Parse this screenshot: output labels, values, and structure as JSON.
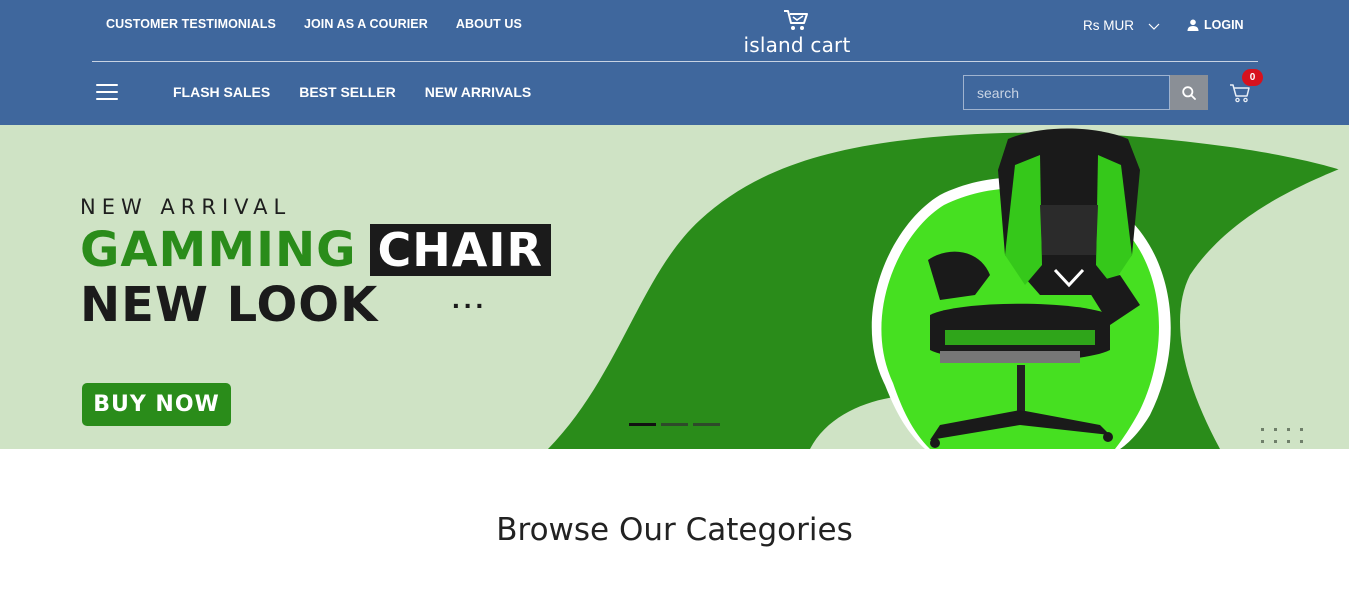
{
  "header": {
    "top_links": [
      "CUSTOMER TESTIMONIALS",
      "JOIN AS A COURIER",
      "ABOUT US"
    ],
    "logo_text": "island cart",
    "currency": "Rs MUR",
    "login_label": "LOGIN",
    "nav_links": [
      "FLASH SALES",
      "BEST SELLER",
      "NEW ARRIVALS"
    ],
    "search_placeholder": "search",
    "cart_count": "0",
    "bg_color": "#3f679d"
  },
  "banner": {
    "eyebrow": "NEW ARRIVAL",
    "headline_green": "GAMMING",
    "headline_boxed": "CHAIR",
    "headline_line2": "NEW LOOK",
    "ellipsis": "...",
    "cta_label": "BUY NOW",
    "slide_count": 3,
    "active_slide": 1,
    "accent_color": "#2a8c1a",
    "bg_color": "#cfe3c5"
  },
  "section": {
    "title": "Browse Our Categories"
  },
  "icons": [
    "cart-icon",
    "chevron-down-icon",
    "user-icon",
    "hamburger-icon",
    "search-icon",
    "shopping-cart-icon",
    "grid-dots-icon"
  ]
}
